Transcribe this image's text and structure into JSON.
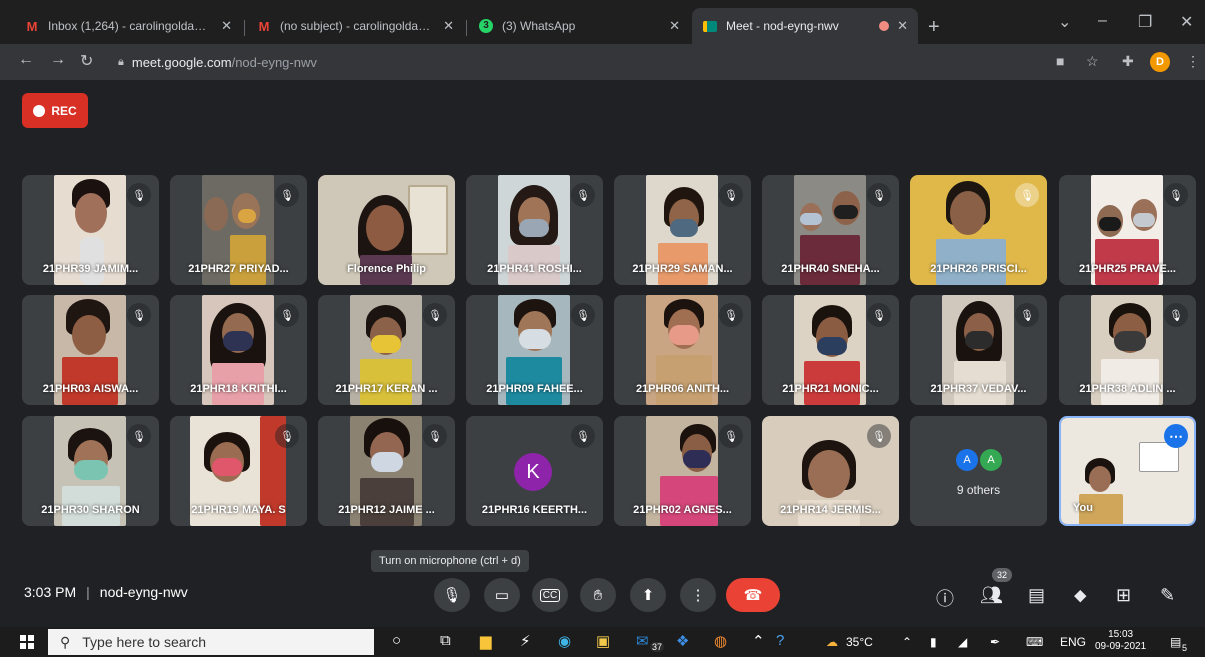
{
  "browser": {
    "tabs": [
      {
        "label": "Inbox (1,264) - carolingolda@wc",
        "icon": "gmail-icon",
        "icon_color": "#ea4335"
      },
      {
        "label": "(no subject) - carolingoldawcc@",
        "icon": "gmail-icon",
        "icon_color": "#ea4335"
      },
      {
        "label": "(3) WhatsApp",
        "icon": "whatsapp-icon",
        "icon_color": "#25d366"
      },
      {
        "label": "Meet - nod-eyng-nwv",
        "icon": "meet-icon",
        "icon_color": "#00897b"
      }
    ],
    "url_host": "meet.google.com",
    "url_path": "/nod-eyng-nwv",
    "profile_initial": "D"
  },
  "recording": {
    "label": "REC"
  },
  "participants": [
    {
      "name": "21PHR39 JAMIM..."
    },
    {
      "name": "21PHR27 PRIYAD..."
    },
    {
      "name": "Florence Philip"
    },
    {
      "name": "21PHR41 ROSHI..."
    },
    {
      "name": "21PHR29 SAMAN..."
    },
    {
      "name": "21PHR40 SNEHA..."
    },
    {
      "name": "21PHR26 PRISCI..."
    },
    {
      "name": "21PHR25 PRAVE..."
    },
    {
      "name": "21PHR03 AISWA..."
    },
    {
      "name": "21PHR18 KRITHI..."
    },
    {
      "name": "21PHR17 KERAN ..."
    },
    {
      "name": "21PHR09 FAHEE..."
    },
    {
      "name": "21PHR06 ANITH..."
    },
    {
      "name": "21PHR21 MONIC..."
    },
    {
      "name": "21PHR37 VEDAV..."
    },
    {
      "name": "21PHR38 ADLIN ..."
    },
    {
      "name": "21PHR30 SHARON"
    },
    {
      "name": "21PHR19 MAYA. S"
    },
    {
      "name": "21PHR12 JAIME ..."
    },
    {
      "name": "21PHR16 KEERTH...",
      "avatar": "K"
    },
    {
      "name": "21PHR02 AGNES..."
    },
    {
      "name": "21PHR14 JERMIS..."
    }
  ],
  "others": {
    "label": "9 others",
    "avatars": [
      "A",
      "A"
    ]
  },
  "self": {
    "label": "You"
  },
  "tooltip": "Turn on microphone (ctrl + d)",
  "meeting": {
    "time": "3:03 PM",
    "code": "nod-eyng-nwv",
    "people_count": "32"
  },
  "taskbar": {
    "search_placeholder": "Type here to search",
    "badge": "37",
    "weather": "35°C",
    "language": "ENG",
    "time": "15:03",
    "date": "09-09-2021",
    "notifications": "5"
  }
}
